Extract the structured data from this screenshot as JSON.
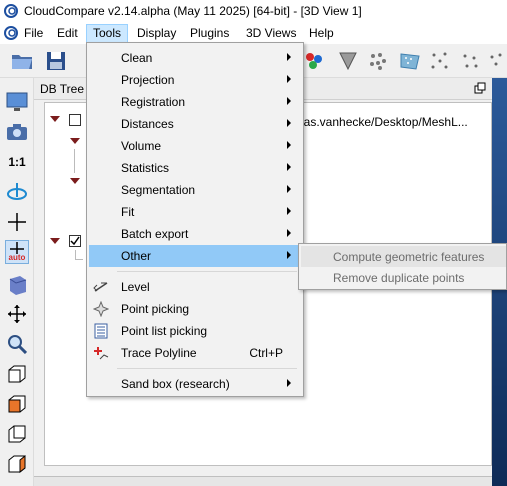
{
  "window": {
    "title": "CloudCompare v2.14.alpha (May 11 2025) [64-bit] - [3D View 1]"
  },
  "menubar": {
    "items": [
      "File",
      "Edit",
      "Tools",
      "Display",
      "Plugins",
      "3D Views",
      "Help"
    ],
    "active": "Tools"
  },
  "db_tree": {
    "title": "DB Tree",
    "path_text": "thias.vanhecke/Desktop/MeshL..."
  },
  "left_toolbar": {
    "one_to_one_label": "1:1",
    "auto_label": "auto"
  },
  "tools_menu": {
    "items": [
      {
        "label": "Clean",
        "submenu": true
      },
      {
        "label": "Projection",
        "submenu": true
      },
      {
        "label": "Registration",
        "submenu": true
      },
      {
        "label": "Distances",
        "submenu": true
      },
      {
        "label": "Volume",
        "submenu": true
      },
      {
        "label": "Statistics",
        "submenu": true
      },
      {
        "label": "Segmentation",
        "submenu": true
      },
      {
        "label": "Fit",
        "submenu": true
      },
      {
        "label": "Batch export",
        "submenu": true
      },
      {
        "label": "Other",
        "submenu": true,
        "highlighted": true
      },
      {
        "label": "Level",
        "icon": "level-icon"
      },
      {
        "label": "Point picking",
        "icon": "point-picking-icon"
      },
      {
        "label": "Point list picking",
        "icon": "point-list-picking-icon"
      },
      {
        "label": "Trace Polyline",
        "icon": "trace-polyline-icon",
        "shortcut": "Ctrl+P"
      },
      {
        "label": "Sand box (research)",
        "submenu": true
      }
    ]
  },
  "other_submenu": {
    "items": [
      {
        "label": "Compute geometric features",
        "disabled": true,
        "highlighted": true
      },
      {
        "label": "Remove duplicate points",
        "disabled": true
      }
    ]
  },
  "colors": {
    "menu_highlight": "#91c9f7",
    "active_menu_bg": "#cce8ff",
    "viewport_blue": "#1a3d73",
    "accent_orange": "#e8752a"
  }
}
